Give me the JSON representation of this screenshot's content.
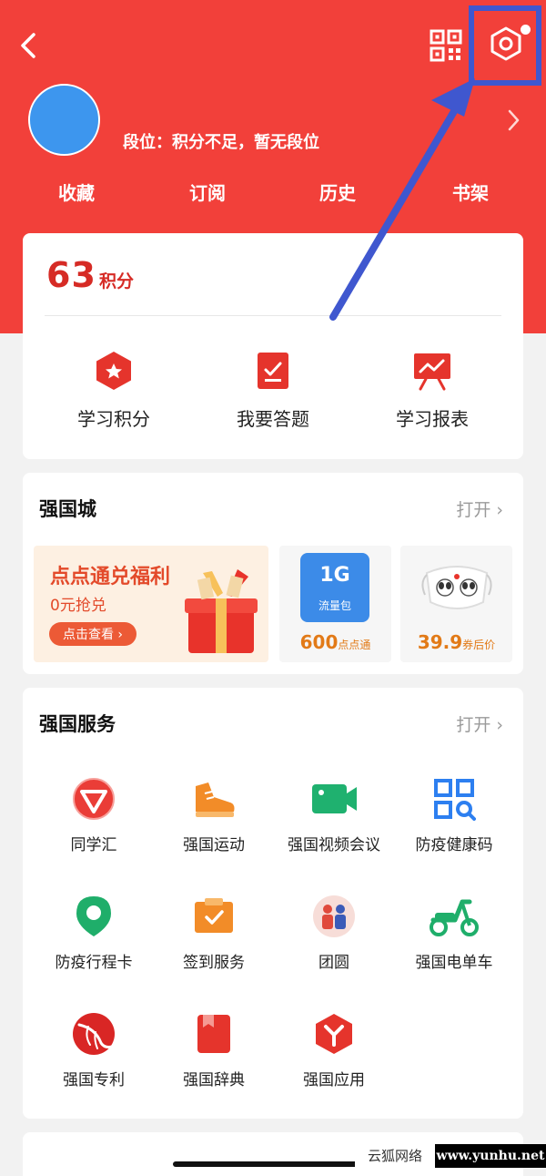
{
  "header": {
    "rank_text": "段位：积分不足，暂无段位",
    "nav": [
      "收藏",
      "订阅",
      "历史",
      "书架"
    ]
  },
  "points": {
    "value": "63",
    "unit": "积分",
    "tools": [
      "学习积分",
      "我要答题",
      "学习报表"
    ]
  },
  "mall": {
    "title": "强国城",
    "open_label": "打开 ›",
    "banner": {
      "title": "点点通兑福利",
      "subtitle": "0元抢兑",
      "button": "点击查看 ›"
    },
    "flow": {
      "amount": "1G",
      "name": "流量包",
      "price": "600",
      "price_unit": "点点通"
    },
    "mask": {
      "price": "39.9",
      "price_unit": "券后价"
    }
  },
  "services": {
    "title": "强国服务",
    "open_label": "打开 ›",
    "items": [
      "同学汇",
      "强国运动",
      "强国视频会议",
      "防疫健康码",
      "防疫行程卡",
      "签到服务",
      "团圆",
      "强国电单车",
      "强国专利",
      "强国辞典",
      "强国应用"
    ]
  },
  "watermark": {
    "left": "云狐网络",
    "right": "www.yunhu.net"
  },
  "colors": {
    "brand_red": "#f2403a",
    "points_red": "#d62b25",
    "annotation_blue": "#3f57cf"
  }
}
